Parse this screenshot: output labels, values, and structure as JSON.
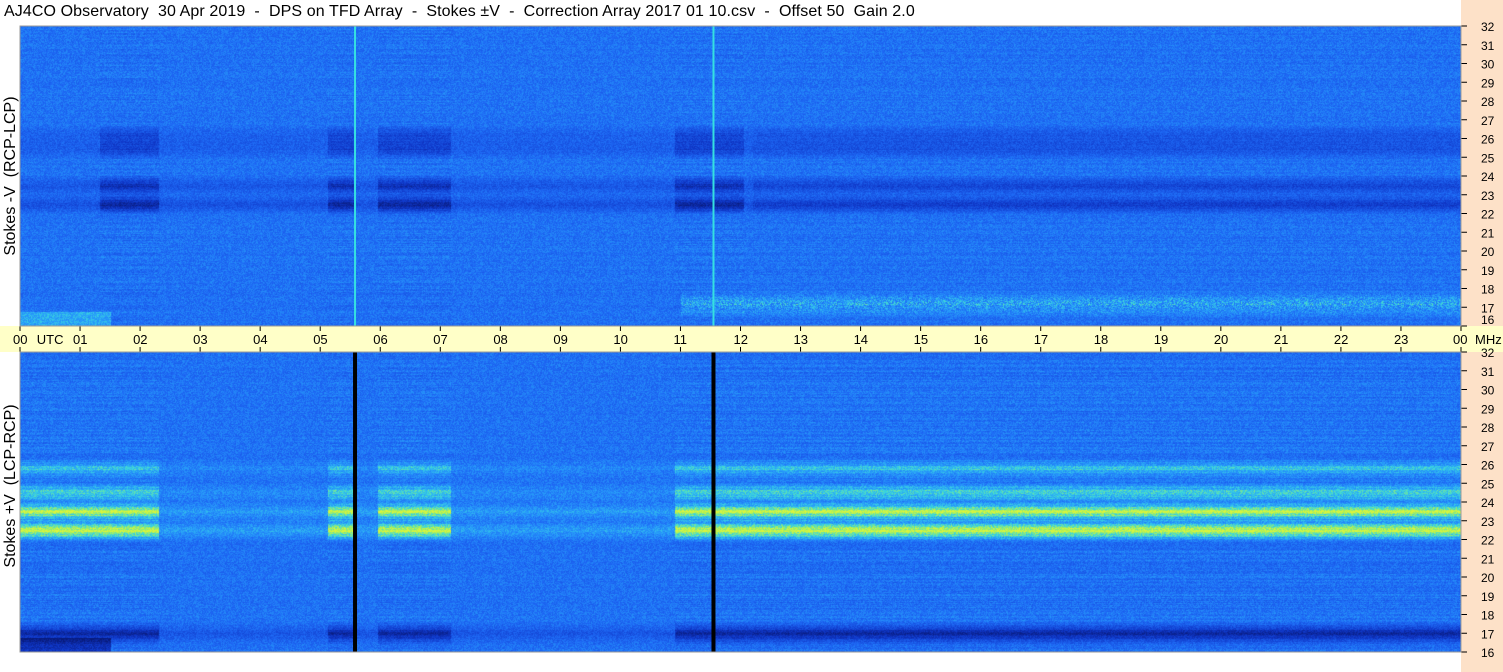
{
  "title": "AJ4CO Observatory  30 Apr 2019  -  DPS on TFD Array  -  Stokes ±V  -  Correction Array 2017 01 10.csv  -  Offset 50  Gain 2.0",
  "colors": {
    "axis_band": "#ffffc8",
    "freq_panel": "#fde1c8",
    "low": "#0b2a9a",
    "mid": "#1f66f2",
    "high": "#c8f040"
  },
  "chart_data": [
    {
      "type": "heatmap",
      "panel": "top",
      "ylabel": "Stokes -V  (RCP-LCP)",
      "y_unit": "",
      "y_ticks": [
        16,
        17,
        18,
        19,
        20,
        21,
        22,
        23,
        24,
        25,
        26,
        27,
        28,
        29,
        30,
        31,
        32
      ],
      "ylim": [
        16,
        32
      ],
      "x_ticks": [
        "00",
        "01",
        "02",
        "03",
        "04",
        "05",
        "06",
        "07",
        "08",
        "09",
        "10",
        "11",
        "12",
        "13",
        "14",
        "15",
        "16",
        "17",
        "18",
        "19",
        "20",
        "21",
        "22",
        "23",
        "00"
      ],
      "xlim": [
        0,
        24
      ],
      "vertical_lines": [
        {
          "x": 5.58,
          "color": "#35e0e0"
        },
        {
          "x": 11.55,
          "color": "#35e0e0"
        }
      ],
      "dark_blocks": [
        [
          1.33,
          2.3
        ],
        [
          5.12,
          5.55
        ],
        [
          5.95,
          7.17
        ],
        [
          10.9,
          12.05
        ]
      ],
      "bands": [
        {
          "y": 22.5,
          "level": -0.85
        },
        {
          "y": 23.5,
          "level": -0.7
        },
        {
          "y": 25.5,
          "level": -0.5
        },
        {
          "y": 26.2,
          "level": -0.4
        },
        {
          "y": 17.2,
          "level": 0.5,
          "from": 11.0
        }
      ]
    },
    {
      "type": "heatmap",
      "panel": "bottom",
      "ylabel": "Stokes +V  (LCP-RCP)",
      "y_unit": "MHz",
      "y_ticks": [
        16,
        17,
        18,
        19,
        20,
        21,
        22,
        23,
        24,
        25,
        26,
        27,
        28,
        29,
        30,
        31,
        32
      ],
      "ylim": [
        16,
        32
      ],
      "x_ticks": [
        "00",
        "01",
        "02",
        "03",
        "04",
        "05",
        "06",
        "07",
        "08",
        "09",
        "10",
        "11",
        "12",
        "13",
        "14",
        "15",
        "16",
        "17",
        "18",
        "19",
        "20",
        "21",
        "22",
        "23",
        "00"
      ],
      "xlim": [
        0,
        24
      ],
      "vertical_lines": [
        {
          "x": 5.58,
          "color": "#000000"
        },
        {
          "x": 11.55,
          "color": "#000000"
        }
      ],
      "bright_blocks": [
        [
          0,
          2.3
        ],
        [
          5.12,
          5.55
        ],
        [
          5.95,
          7.17
        ],
        [
          10.9,
          24
        ]
      ],
      "bands": [
        {
          "y": 22.5,
          "level": 0.95
        },
        {
          "y": 23.5,
          "level": 0.9
        },
        {
          "y": 24.5,
          "level": 0.6
        },
        {
          "y": 25.8,
          "level": 0.45
        },
        {
          "y": 17.0,
          "level": -0.8
        }
      ]
    }
  ],
  "axis": {
    "utc_label": "UTC",
    "mhz_label": "MHz"
  }
}
